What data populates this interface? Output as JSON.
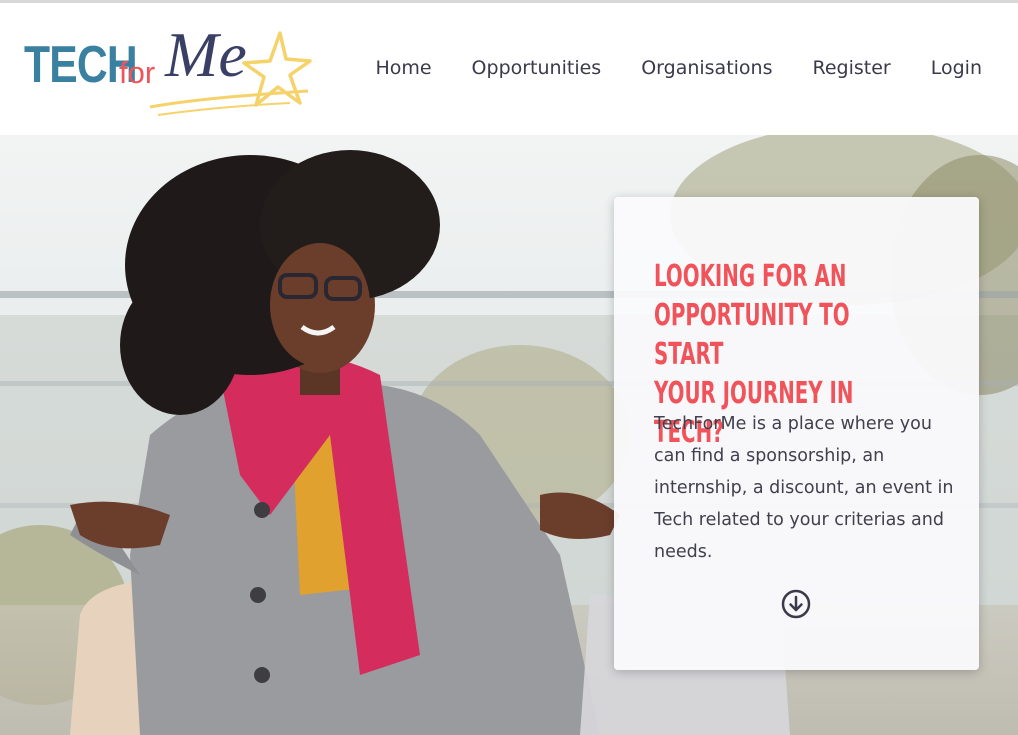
{
  "brand": {
    "logo_tech": "TECH",
    "logo_for": "for",
    "logo_me": "Me",
    "colors": {
      "tech": "#3a80a0",
      "for": "#f0545a",
      "me": "#3a3f66",
      "star": "#f5d26a"
    }
  },
  "nav": {
    "items": [
      {
        "label": "Home"
      },
      {
        "label": "Opportunities"
      },
      {
        "label": "Organisations"
      },
      {
        "label": "Register"
      },
      {
        "label": "Login"
      }
    ]
  },
  "hero": {
    "photo_icon": "woman-with-laptop-photo",
    "title": "Looking for an\nopportunity to start\nyour journey in tech?",
    "description": "TechForMe is a place where you can find a sponsorship, an internship, a discount, an event in Tech related to your criterias and needs.",
    "scroll_icon": "arrow-circle-down-icon",
    "accent_color": "#f0545a",
    "text_color": "#40404e"
  }
}
